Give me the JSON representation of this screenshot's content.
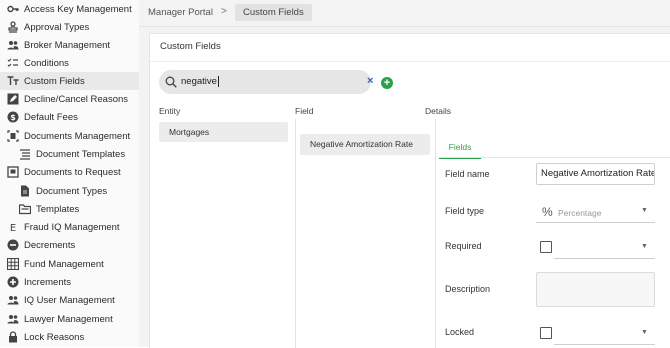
{
  "sidebar": {
    "items": [
      {
        "label": "Access Key Management",
        "icon": "key-icon"
      },
      {
        "label": "Approval Types",
        "icon": "stamp-icon"
      },
      {
        "label": "Broker Management",
        "icon": "people-icon"
      },
      {
        "label": "Conditions",
        "icon": "checklist-icon"
      },
      {
        "label": "Custom Fields",
        "icon": "text-format-icon",
        "active": true
      },
      {
        "label": "Decline/Cancel Reasons",
        "icon": "edit-icon"
      },
      {
        "label": "Default Fees",
        "icon": "dollar-icon"
      },
      {
        "label": "Documents Management",
        "icon": "document-frame-icon"
      },
      {
        "label": "Document Templates",
        "icon": "list-icon",
        "indent": true
      },
      {
        "label": "Documents to Request",
        "icon": "document-request-icon"
      },
      {
        "label": "Document Types",
        "icon": "file-icon",
        "indent": true
      },
      {
        "label": "Templates",
        "icon": "folder-icon",
        "indent": true
      },
      {
        "label": "Fraud IQ Management",
        "icon": "letter-e-icon"
      },
      {
        "label": "Decrements",
        "icon": "minus-circle-icon"
      },
      {
        "label": "Fund Management",
        "icon": "grid-icon"
      },
      {
        "label": "Increments",
        "icon": "plus-circle-icon"
      },
      {
        "label": "IQ User Management",
        "icon": "people-icon"
      },
      {
        "label": "Lawyer Management",
        "icon": "people-icon"
      },
      {
        "label": "Lock Reasons",
        "icon": "lock-icon"
      }
    ]
  },
  "breadcrumb": {
    "root": "Manager Portal",
    "separator": ">",
    "current": "Custom Fields"
  },
  "panel": {
    "title": "Custom Fields"
  },
  "search": {
    "value": "negative",
    "clear": "×"
  },
  "add_button": "+",
  "columns": {
    "entity": "Entity",
    "field": "Field",
    "details": "Details"
  },
  "entity_item": "Mortgages",
  "field_item": "Negative Amortization Rate",
  "tabs": {
    "fields": "Fields"
  },
  "form": {
    "field_name_label": "Field name",
    "field_name_value": "Negative Amortization Rate",
    "field_type_label": "Field type",
    "field_type_symbol": "%",
    "field_type_value": "Percentage",
    "required_label": "Required",
    "description_label": "Description",
    "locked_label": "Locked"
  },
  "colors": {
    "accent": "#2aa149",
    "clear": "#3a5ca8",
    "active_nav": "#e9e9e9"
  }
}
